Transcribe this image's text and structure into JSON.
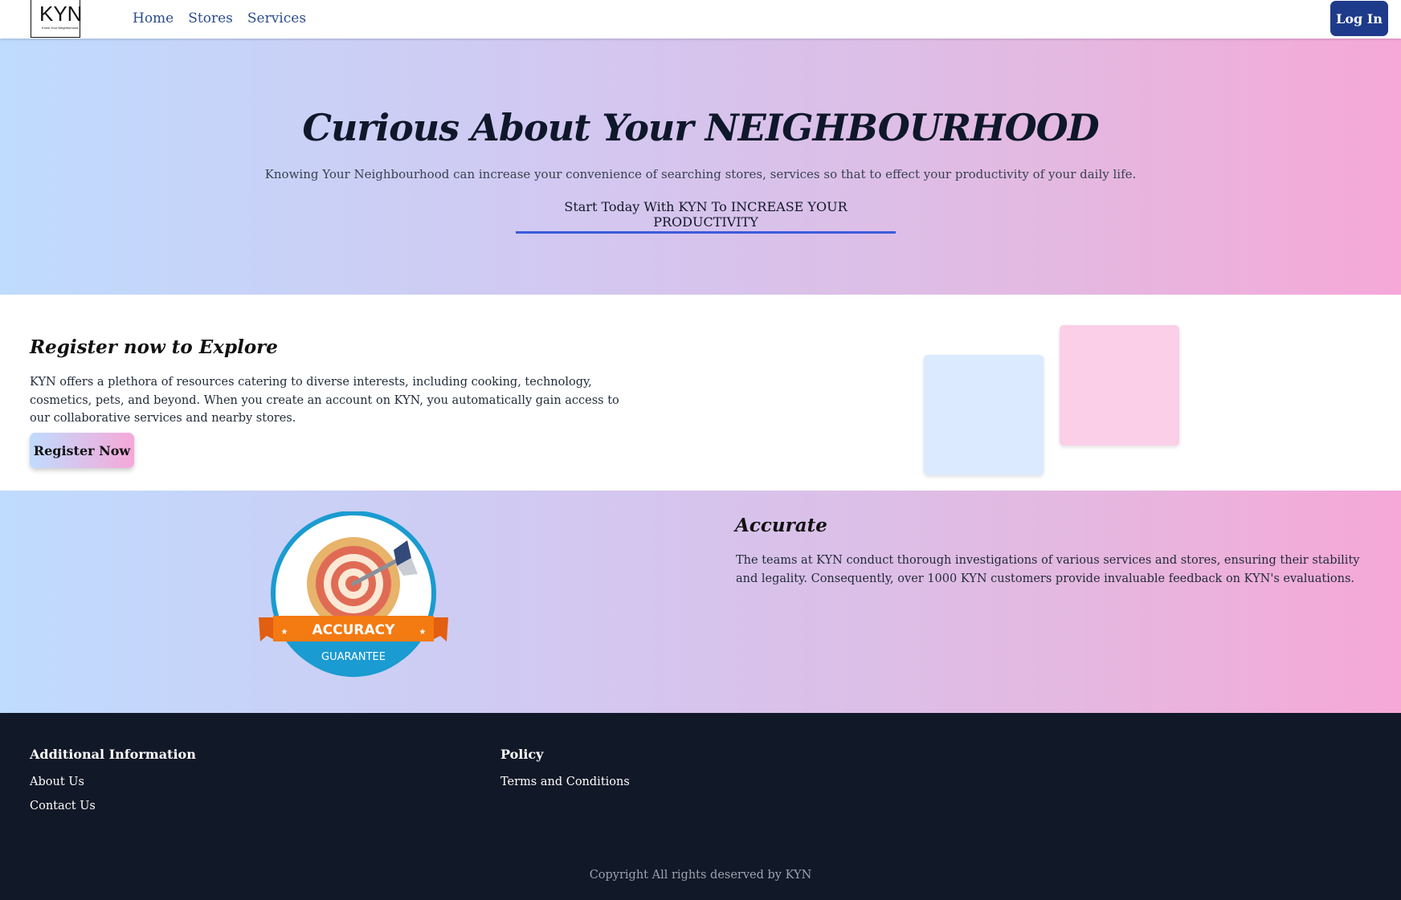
{
  "header": {
    "logo_text": "KYN",
    "logo_tagline": "Know Your Neighborhood",
    "nav": [
      {
        "label": "Home"
      },
      {
        "label": "Stores"
      },
      {
        "label": "Services"
      }
    ],
    "login_label": "Log In"
  },
  "hero": {
    "title": "Curious About Your NEIGHBOURHOOD",
    "subtitle": "Knowing Your Neighbourhood can increase your convenience of searching stores, services so that to effect your productivity of your daily life.",
    "cta": "Start Today With KYN To INCREASE YOUR PRODUCTIVITY"
  },
  "register": {
    "heading_prefix": "Register now to ",
    "heading_emphasis": "Explore",
    "text": "KYN offers a plethora of resources catering to diverse interests, including cooking, technology, cosmetics, pets, and beyond. When you create an account on KYN, you automatically gain access to our collaborative services and nearby stores.",
    "button_label": "Register Now"
  },
  "accurate": {
    "badge_top": "ACCURACY",
    "badge_bottom": "GUARANTEE",
    "heading": "Accurate",
    "text": "The teams at KYN conduct thorough investigations of various services and stores, ensuring their stability and legality. Consequently, over 1000 KYN customers provide invaluable feedback on KYN's evaluations."
  },
  "footer": {
    "col1_heading": "Additional Information",
    "col1_links": [
      {
        "label": "About Us"
      },
      {
        "label": "Contact Us"
      }
    ],
    "col2_heading": "Policy",
    "col2_links": [
      {
        "label": "Terms and Conditions"
      }
    ],
    "copyright": "Copyright All rights deserved by KYN"
  },
  "colors": {
    "brand_dark": "#1e3a8a",
    "gradient_start": "#bfdbfe",
    "gradient_end": "#f6a8d8",
    "footer_bg": "#111827"
  }
}
